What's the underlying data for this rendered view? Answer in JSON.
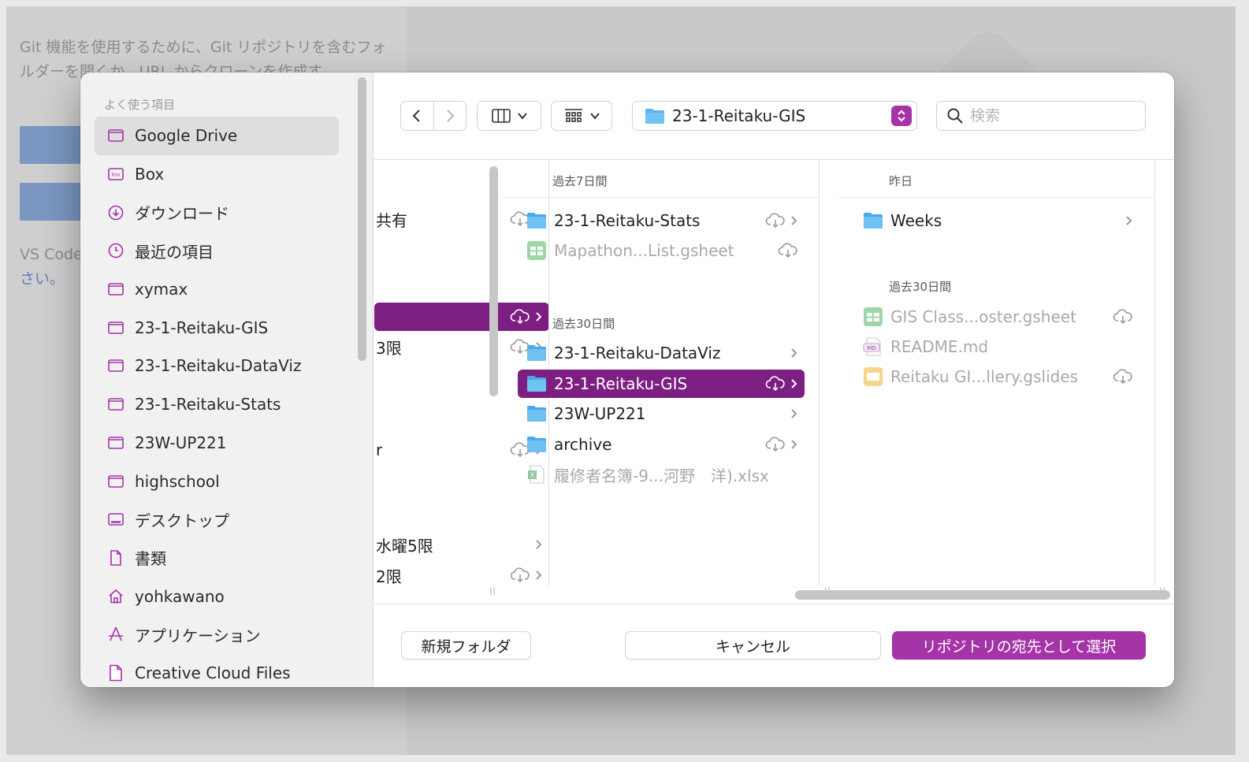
{
  "background": {
    "text_top": "Git 機能を使用するために、Git リポジトリを含むフォルダーを開くか、URL からクローンを作成す",
    "text_bottom": "VS Code の詳細に",
    "text_link": "さい。"
  },
  "sidebar": {
    "header": "よく使う項目",
    "items": [
      {
        "label": "Google Drive",
        "icon": "folder-icon",
        "selected": true
      },
      {
        "label": "Box",
        "icon": "box-icon"
      },
      {
        "label": "ダウンロード",
        "icon": "download-icon"
      },
      {
        "label": "最近の項目",
        "icon": "clock-icon"
      },
      {
        "label": "xymax",
        "icon": "folder-icon"
      },
      {
        "label": "23-1-Reitaku-GIS",
        "icon": "folder-icon"
      },
      {
        "label": "23-1-Reitaku-DataViz",
        "icon": "folder-icon"
      },
      {
        "label": "23-1-Reitaku-Stats",
        "icon": "folder-icon"
      },
      {
        "label": "23W-UP221",
        "icon": "folder-icon"
      },
      {
        "label": "highschool",
        "icon": "folder-icon"
      },
      {
        "label": "デスクトップ",
        "icon": "desktop-icon"
      },
      {
        "label": "書類",
        "icon": "document-icon"
      },
      {
        "label": "yohkawano",
        "icon": "home-icon"
      },
      {
        "label": "アプリケーション",
        "icon": "applications-icon"
      },
      {
        "label": "Creative Cloud Files",
        "icon": "file-icon"
      }
    ]
  },
  "toolbar": {
    "path": "23-1-Reitaku-GIS",
    "search_placeholder": "検索"
  },
  "columns": {
    "col1": {
      "rows": [
        {
          "label": "共有"
        },
        {
          "label": ""
        },
        {
          "label": "3限"
        },
        {
          "label": "r"
        },
        {
          "label": "水曜5限"
        },
        {
          "label": "2限"
        }
      ]
    },
    "col2": {
      "section1": "過去7日間",
      "section2": "過去30日間",
      "items7": [
        {
          "label": "23-1-Reitaku-Stats"
        },
        {
          "label": "Mapathon...List.gsheet"
        }
      ],
      "items30": [
        {
          "label": "23-1-Reitaku-DataViz"
        },
        {
          "label": "23-1-Reitaku-GIS"
        },
        {
          "label": "23W-UP221"
        },
        {
          "label": "archive"
        },
        {
          "label": "履修者名簿-9...河野　洋).xlsx"
        }
      ]
    },
    "col3": {
      "section1": "昨日",
      "section2": "過去30日間",
      "items_yesterday": [
        {
          "label": "Weeks"
        }
      ],
      "items30": [
        {
          "label": "GIS Class...oster.gsheet"
        },
        {
          "label": "README.md"
        },
        {
          "label": "Reitaku GI...llery.gslides"
        }
      ]
    }
  },
  "footer": {
    "new_folder": "新規フォルダ",
    "cancel": "キャンセル",
    "select": "リポジトリの宛先として選択"
  },
  "colors": {
    "accent": "#a534a8",
    "selection": "#7d1e82",
    "folder": "#5bb4ec"
  }
}
